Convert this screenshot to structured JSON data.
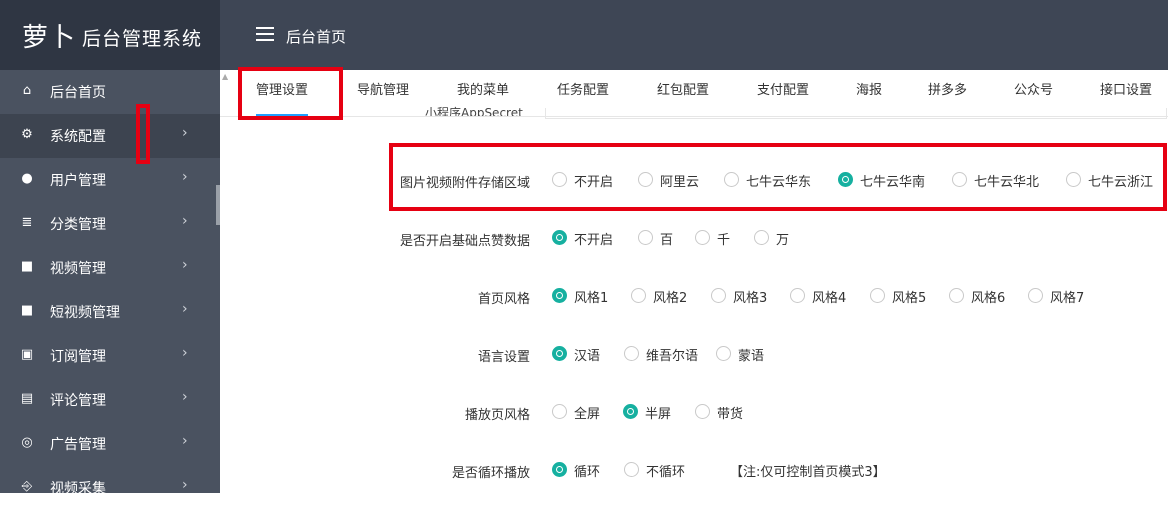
{
  "app": {
    "logo": "萝卜",
    "title": "后台管理系统"
  },
  "header": {
    "page_title": "后台首页"
  },
  "sidebar": {
    "items": [
      {
        "label": "后台首页",
        "icon": "home-icon"
      },
      {
        "label": "系统配置",
        "icon": "gear-icon"
      },
      {
        "label": "用户管理",
        "icon": "user-icon"
      },
      {
        "label": "分类管理",
        "icon": "stack-icon"
      },
      {
        "label": "视频管理",
        "icon": "video-icon"
      },
      {
        "label": "短视频管理",
        "icon": "video-icon"
      },
      {
        "label": "订阅管理",
        "icon": "subscribe-icon"
      },
      {
        "label": "评论管理",
        "icon": "comment-icon"
      },
      {
        "label": "广告管理",
        "icon": "target-icon"
      },
      {
        "label": "视频采集",
        "icon": "collect-icon"
      }
    ]
  },
  "tabs": [
    "管理设置",
    "导航管理",
    "我的菜单",
    "任务配置",
    "红包配置",
    "支付配置",
    "海报",
    "拼多多",
    "公众号",
    "接口设置"
  ],
  "form": {
    "partial_label": "小程序AppSecret",
    "rows": [
      {
        "label": "图片视频附件存储区域",
        "options": [
          "不开启",
          "阿里云",
          "七牛云华东",
          "七牛云华南",
          "七牛云华北",
          "七牛云浙江"
        ],
        "selected": 3
      },
      {
        "label": "是否开启基础点赞数据",
        "options": [
          "不开启",
          "百",
          "千",
          "万"
        ],
        "selected": 0
      },
      {
        "label": "首页风格",
        "options": [
          "风格1",
          "风格2",
          "风格3",
          "风格4",
          "风格5",
          "风格6",
          "风格7"
        ],
        "selected": 0
      },
      {
        "label": "语言设置",
        "options": [
          "汉语",
          "维吾尔语",
          "蒙语"
        ],
        "selected": 0
      },
      {
        "label": "播放页风格",
        "options": [
          "全屏",
          "半屏",
          "带货"
        ],
        "selected": 1
      },
      {
        "label": "是否循环播放",
        "options": [
          "循环",
          "不循环"
        ],
        "selected": 0,
        "note": "【注:仅可控制首页模式3】"
      }
    ]
  },
  "colors": {
    "topbar": "#3e4655",
    "sidebar": "#4a5260",
    "radio_on": "#16b0a0",
    "tab_active": "#1e9fff",
    "highlight": "#e60012"
  }
}
